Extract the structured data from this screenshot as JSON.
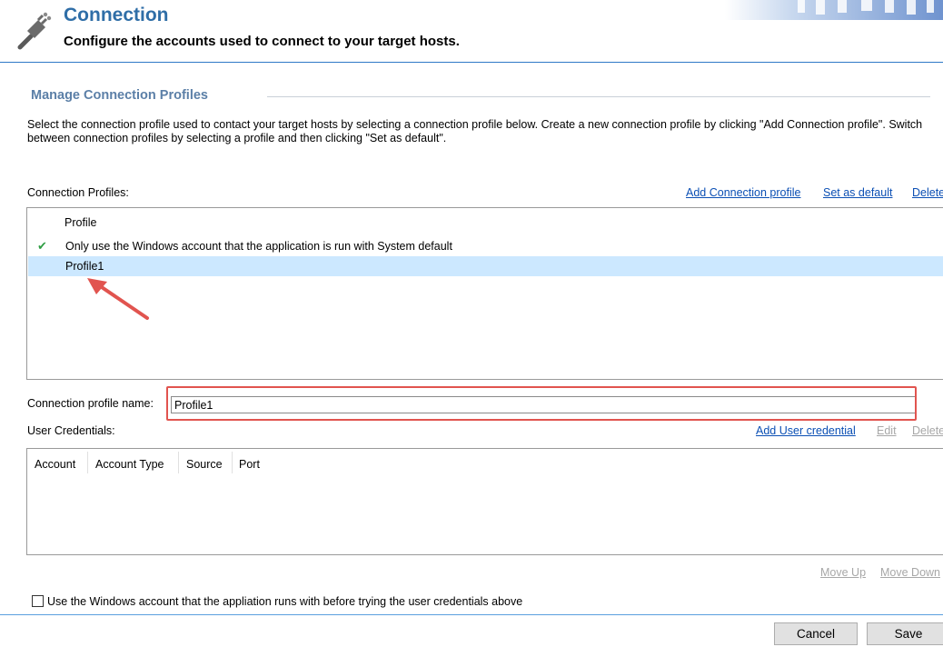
{
  "header": {
    "title": "Connection",
    "subtitle": "Configure the accounts used to connect to your target hosts.",
    "icon": "plug-icon"
  },
  "section": {
    "title": "Manage Connection Profiles",
    "description": "Select the connection profile used to contact your target hosts by selecting a connection profile below. Create a new connection profile by clicking \"Add Connection profile\". Switch between connection profiles by selecting a profile and then clicking \"Set as default\"."
  },
  "profiles": {
    "label": "Connection Profiles:",
    "actions": {
      "add": "Add Connection profile",
      "set_default": "Set as default",
      "delete": "Delete"
    },
    "column_header": "Profile",
    "rows": [
      {
        "name": "Only use the Windows account that the application is run with System default",
        "is_default": true,
        "selected": false
      },
      {
        "name": "Profile1",
        "is_default": false,
        "selected": true
      }
    ]
  },
  "profile_name": {
    "label": "Connection profile name:",
    "value": "Profile1"
  },
  "credentials": {
    "label": "User Credentials:",
    "actions": {
      "add": "Add User credential",
      "edit": "Edit",
      "delete": "Delete"
    },
    "columns": [
      "Account",
      "Account Type",
      "Source",
      "Port"
    ],
    "rows": [],
    "move_up": "Move Up",
    "move_down": "Move Down"
  },
  "windows_account_option": {
    "label": "Use the Windows account that the appliation runs with before trying the user credentials above",
    "checked": false
  },
  "buttons": {
    "cancel": "Cancel",
    "save": "Save"
  },
  "colors": {
    "title": "#2f6ea7",
    "link": "#0b4fb4",
    "selected_row": "#cce8ff",
    "annotation": "#e1544f",
    "check": "#2f9e44"
  }
}
